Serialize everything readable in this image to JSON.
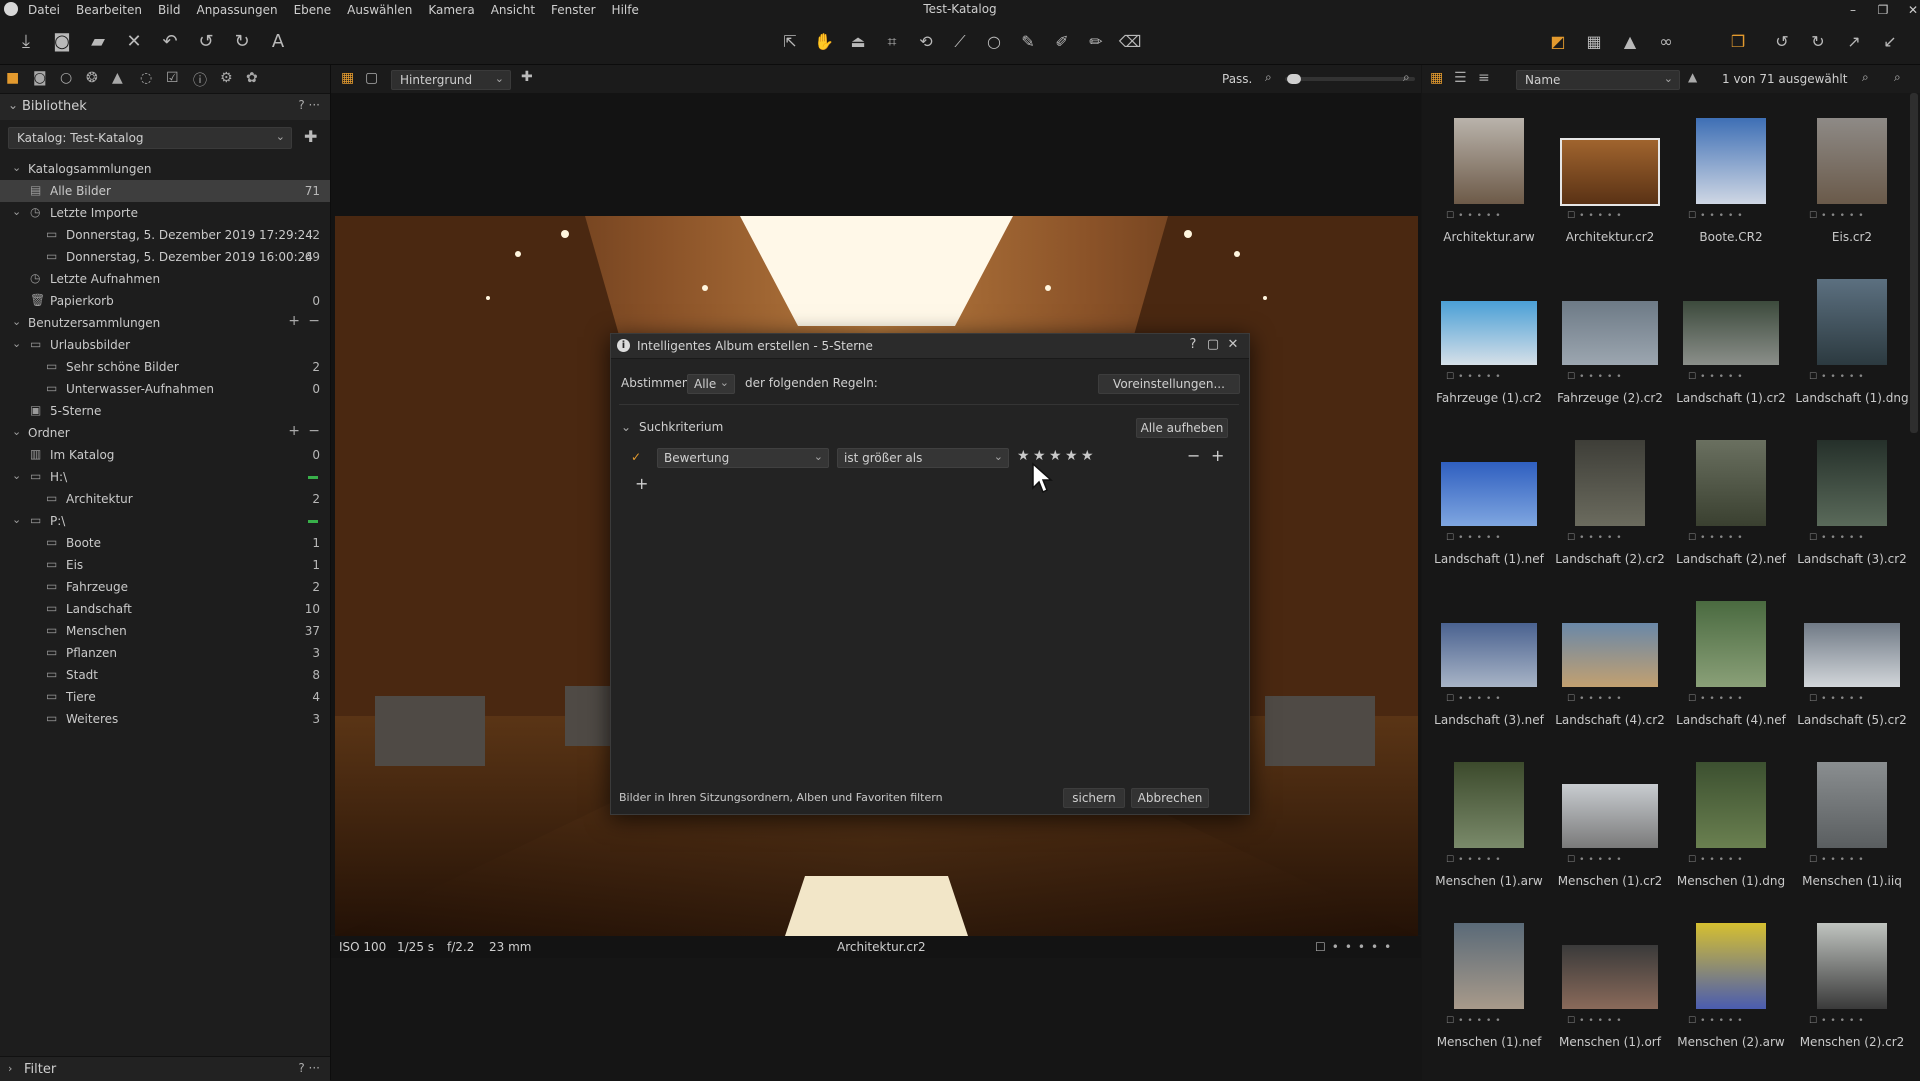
{
  "app": {
    "window_title": "Test-Katalog",
    "menu": [
      "Datei",
      "Bearbeiten",
      "Bild",
      "Anpassungen",
      "Ebene",
      "Auswählen",
      "Kamera",
      "Ansicht",
      "Fenster",
      "Hilfe"
    ],
    "window_controls": {
      "minimize": "–",
      "restore": "❐",
      "close": "✕"
    }
  },
  "library": {
    "title": "Bibliothek",
    "help": "?",
    "more": "···",
    "catalog_value": "Katalog: Test-Katalog",
    "catalog_collections": "Katalogsammlungen",
    "all_images": {
      "label": "Alle Bilder",
      "count": "71"
    },
    "recent_imports": "Letzte Importe",
    "imports": [
      {
        "label": "Donnerstag, 5. Dezember 2019 17:29:24",
        "count": "2"
      },
      {
        "label": "Donnerstag, 5. Dezember 2019 16:00:24",
        "count": "69"
      }
    ],
    "recent_captures": "Letzte Aufnahmen",
    "trash": {
      "label": "Papierkorb",
      "count": "0"
    },
    "user_collections": "Benutzersammlungen",
    "vacation": "Urlaubsbilder",
    "vacation_items": [
      {
        "label": "Sehr schöne Bilder",
        "count": "2"
      },
      {
        "label": "Unterwasser-Aufnahmen",
        "count": "0"
      }
    ],
    "five_stars": "5-Sterne",
    "folders": "Ordner",
    "in_catalog": {
      "label": "Im Katalog",
      "count": "0"
    },
    "drive_h": "H:\\",
    "drive_h_items": [
      {
        "label": "Architektur",
        "count": "2"
      }
    ],
    "drive_p": "P:\\",
    "drive_p_items": [
      {
        "label": "Boote",
        "count": "1"
      },
      {
        "label": "Eis",
        "count": "1"
      },
      {
        "label": "Fahrzeuge",
        "count": "2"
      },
      {
        "label": "Landschaft",
        "count": "10"
      },
      {
        "label": "Menschen",
        "count": "37"
      },
      {
        "label": "Pflanzen",
        "count": "3"
      },
      {
        "label": "Stadt",
        "count": "8"
      },
      {
        "label": "Tiere",
        "count": "4"
      },
      {
        "label": "Weiteres",
        "count": "3"
      }
    ],
    "filter": "Filter"
  },
  "viewer": {
    "layer_select": "Hintergrund",
    "fit_label": "Pass.",
    "iso": "ISO 100",
    "shutter": "1/25 s",
    "aperture": "f/2.2",
    "focal": "23 mm",
    "filename": "Architektur.cr2"
  },
  "browser": {
    "sort_select": "Name",
    "selection_count": "1 von 71 ausgewählt",
    "thumbnails": [
      "Architektur.arw",
      "Architektur.cr2",
      "Boote.CR2",
      "Eis.cr2",
      "Fahrzeuge (1).cr2",
      "Fahrzeuge (2).cr2",
      "Landschaft (1).cr2",
      "Landschaft (1).dng",
      "Landschaft (1).nef",
      "Landschaft (2).cr2",
      "Landschaft (2).nef",
      "Landschaft (3).cr2",
      "Landschaft (3).nef",
      "Landschaft (4).cr2",
      "Landschaft (4).nef",
      "Landschaft (5).cr2",
      "Menschen (1).arw",
      "Menschen (1).cr2",
      "Menschen (1).dng",
      "Menschen (1).iiq",
      "Menschen (1).nef",
      "Menschen (1).orf",
      "Menschen (2).arw",
      "Menschen (2).cr2"
    ],
    "selected_index": 1
  },
  "dialog": {
    "title": "Intelligentes Album erstellen - 5-Sterne",
    "help": "?",
    "match_label": "Abstimmen",
    "match_value": "Alle",
    "rules_label": "der folgenden Regeln:",
    "presets_button": "Voreinstellungen...",
    "criteria_label": "Suchkriterium",
    "clear_all_button": "Alle aufheben",
    "rule_field": "Bewertung",
    "rule_operator": "ist größer als",
    "rule_stars": [
      "★",
      "★",
      "★",
      "★",
      "★"
    ],
    "remove_rule": "−",
    "add_rule": "+",
    "add_criterion": "+",
    "footer_text": "Bilder in Ihren Sitzungsordnern, Alben und Favoriten filtern",
    "save_button": "sichern",
    "cancel_button": "Abbrechen"
  },
  "colors": {
    "accent": "#e39a2e",
    "status_green": "#38b04a"
  }
}
